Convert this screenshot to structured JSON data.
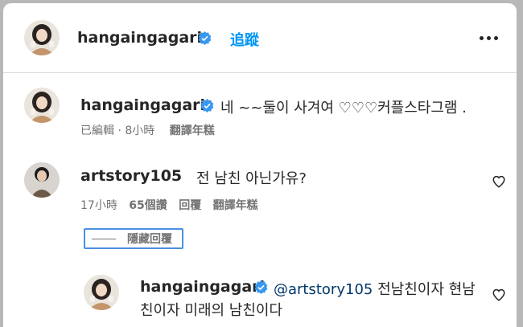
{
  "header": {
    "username": "hangaingagari",
    "follow_label": "追蹤"
  },
  "caption": {
    "username": "hangaingagari",
    "text": "네 ~~둘이 사겨여 ♡♡♡커플스타그램 .",
    "edited": "已編輯",
    "separator": "·",
    "time": "8小時",
    "translate": "翻譯年糕"
  },
  "comment": {
    "username": "artstory105",
    "text": "전 남친 아닌가유?",
    "time": "17小時",
    "likes": "65個讚",
    "reply": "回覆",
    "translate": "翻譯年糕"
  },
  "hide_replies": {
    "label": "隱藏回覆"
  },
  "reply": {
    "username": "hangaingagari",
    "mention": "@artstory105",
    "text_line1": " 전남친이자 현남",
    "text_line2": "친이자 미래의 남친이다"
  },
  "colors": {
    "accent": "#0095f6",
    "verified": "#3897f0",
    "mention": "#00376b",
    "meta": "#737373"
  }
}
